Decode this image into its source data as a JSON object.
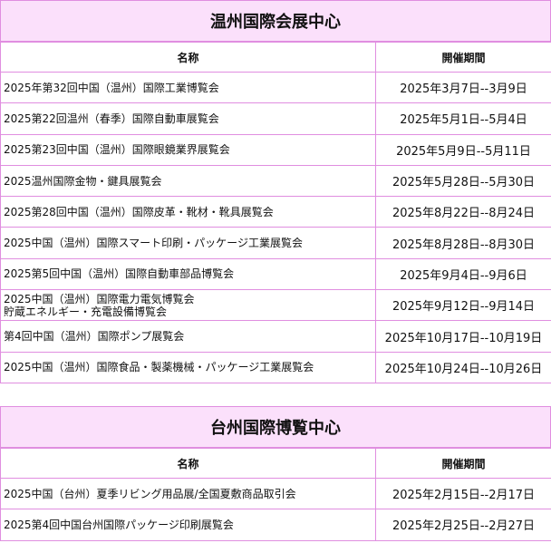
{
  "venues": [
    {
      "title": "温州国際会展中心",
      "headers": {
        "name": "名称",
        "period": "開催期間"
      },
      "rows": [
        {
          "name": [
            "2025年第32回中国（温州）国際工業博覧会"
          ],
          "period": "2025年3月7日--3月9日"
        },
        {
          "name": [
            "2025第22回温州（春季）国際自動車展覧会"
          ],
          "period": "2025年5月1日--5月4日"
        },
        {
          "name": [
            "2025第23回中国（温州）国際眼鏡業界展覧会"
          ],
          "period": "2025年5月9日--5月11日"
        },
        {
          "name": [
            "2025温州国際金物・鍵具展覧会"
          ],
          "period": "2025年5月28日--5月30日"
        },
        {
          "name": [
            "2025第28回中国（温州）国際皮革・靴材・靴具展覧会"
          ],
          "period": "2025年8月22日--8月24日"
        },
        {
          "name": [
            "2025中国（温州）国際スマート印刷・パッケージ工業展覧会"
          ],
          "period": "2025年8月28日--8月30日"
        },
        {
          "name": [
            "2025第5回中国（温州）国際自動車部品博覧会"
          ],
          "period": "2025年9月4日--9月6日"
        },
        {
          "name": [
            "2025中国（温州）国際電力電気博覧会",
            "貯蔵エネルギー・充電設備博覧会"
          ],
          "period": "2025年9月12日--9月14日"
        },
        {
          "name": [
            "第4回中国（温州）国際ポンプ展覧会"
          ],
          "period": "2025年10月17日--10月19日"
        },
        {
          "name": [
            "2025中国（温州）国際食品・製薬機械・パッケージ工業展覧会"
          ],
          "period": "2025年10月24日--10月26日"
        }
      ]
    },
    {
      "title": "台州国際博覧中心",
      "headers": {
        "name": "名称",
        "period": "開催期間"
      },
      "rows": [
        {
          "name": [
            "2025中国（台州）夏季リビング用品展/全国夏敷商品取引会"
          ],
          "period": "2025年2月15日--2月17日"
        },
        {
          "name": [
            "2025第4回中国台州国際パッケージ印刷展覧会"
          ],
          "period": "2025年2月25日--2月27日"
        }
      ]
    }
  ]
}
